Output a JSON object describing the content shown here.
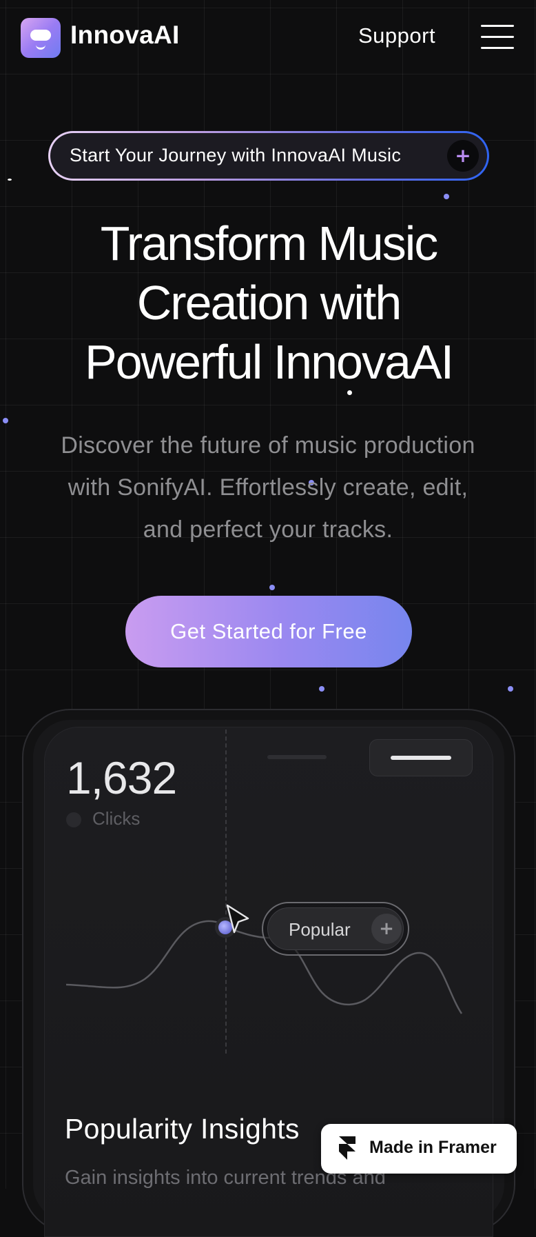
{
  "header": {
    "brand": "InnovaAI",
    "support_label": "Support"
  },
  "announcement": {
    "text": "Start Your Journey with InnovaAI Music",
    "icon": "plus-icon"
  },
  "hero": {
    "title_line1": "Transform Music",
    "title_line2": "Creation with",
    "title_line3": "Powerful InnovaAI",
    "subtitle_line1": "Discover the future of music production",
    "subtitle_line2": "with SonifyAI. Effortlessly create, edit,",
    "subtitle_line3": "and perfect your tracks.",
    "cta_label": "Get Started for Free"
  },
  "preview": {
    "stat_value": "1,632",
    "stat_label": "Clicks",
    "tag_label": "Popular",
    "section_title": "Popularity Insights",
    "section_body": "Gain insights into current trends and"
  },
  "badge": {
    "label": "Made in Framer"
  },
  "colors": {
    "background": "#0e0e0f",
    "accent_purple": "#c99cf0",
    "accent_blue": "#7786ee",
    "dot": "#8b8ef5"
  }
}
